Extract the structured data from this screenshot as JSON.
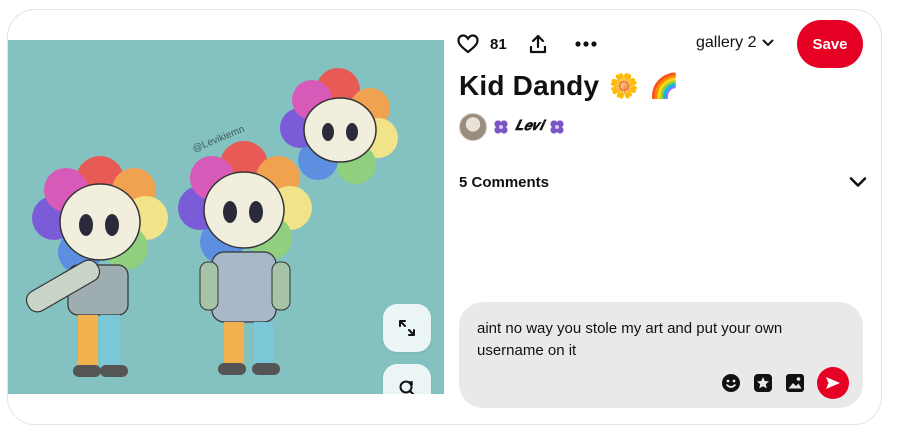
{
  "pin": {
    "title": "Kid Dandy",
    "title_emojis": [
      "🌼",
      "🌈"
    ],
    "likes": "81",
    "author": {
      "name": "𝑳𝒆𝒗𝒊",
      "decorations": [
        "purple-flower-icon",
        "purple-flower-icon"
      ]
    },
    "image": {
      "subject": "drawing of rainbow flower-headed character on teal background",
      "watermark": "@Levikiemn",
      "background_color": "#84c2c1"
    }
  },
  "toolbar": {
    "board_name": "gallery 2",
    "save_label": "Save",
    "icons": [
      "heart-icon",
      "share-icon",
      "more-icon",
      "chevron-down-icon"
    ]
  },
  "comments": {
    "label": "5 Comments",
    "toggle_icon": "chevron-down-icon"
  },
  "composer": {
    "value": "aint no way you stole my art and put your own username on it",
    "tools": [
      "emoji-icon",
      "sticker-icon",
      "image-icon",
      "send-icon"
    ]
  },
  "image_controls": [
    "expand-icon",
    "visual-search-icon"
  ],
  "colors": {
    "accent": "#e60023",
    "composer_bg": "#e9e9e9",
    "image_bg": "#84c2c1"
  }
}
